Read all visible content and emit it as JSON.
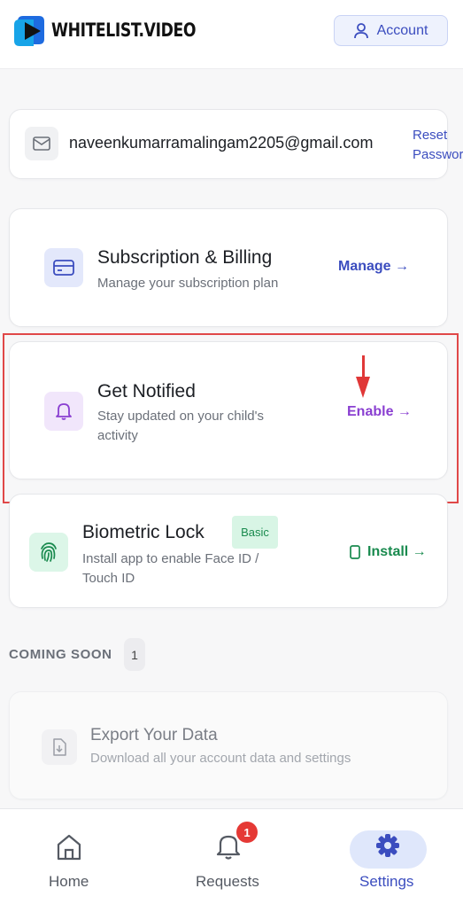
{
  "header": {
    "logo_text": "WHITELIST.VIDEO",
    "account_label": "Account"
  },
  "email_card": {
    "email": "naveenkumarramalingam2205@gmail.com",
    "reset_line1": "Reset",
    "reset_line2": "Password"
  },
  "subscription": {
    "title": "Subscription & Billing",
    "subtitle": "Manage your subscription plan",
    "action": "Manage →"
  },
  "notifications": {
    "title": "Get Notified",
    "subtitle_line1": "Stay updated on your child's",
    "subtitle_line2": "activity",
    "action": "Enable →"
  },
  "biometric": {
    "title": "Biometric Lock",
    "badge": "Basic",
    "subtitle_line1": "Install app to enable Face ID /",
    "subtitle_line2": "Touch ID",
    "action": "Install →"
  },
  "coming_soon": {
    "heading": "COMING SOON",
    "count": "1",
    "items": [
      {
        "title": "Export Your Data",
        "subtitle": "Download all your account data and settings"
      }
    ]
  },
  "bottom_nav": {
    "items": [
      {
        "label": "Home",
        "icon": "home-icon",
        "active": false
      },
      {
        "label": "Requests",
        "icon": "bell-icon",
        "active": false,
        "badge": "1"
      },
      {
        "label": "Settings",
        "icon": "gear-icon",
        "active": true
      }
    ]
  },
  "colors": {
    "primary": "#3b4dbf",
    "notify": "#8a3fd1",
    "install": "#198a4e",
    "highlight": "#e04848"
  }
}
